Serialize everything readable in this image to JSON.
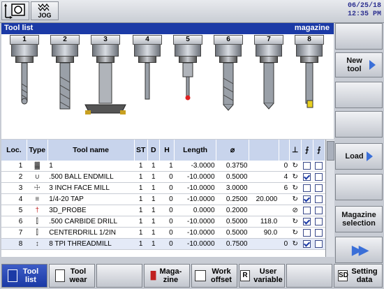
{
  "header": {
    "mode": "JOG",
    "date": "06/25/18",
    "time": "12:35 PM"
  },
  "panel": {
    "title": "Tool list",
    "right_label": "magazine"
  },
  "magazine": {
    "locations": [
      "1",
      "2",
      "3",
      "4",
      "5",
      "6",
      "7",
      "8"
    ]
  },
  "table": {
    "headers": [
      "Loc.",
      "Type",
      "Tool name",
      "ST",
      "D",
      "H",
      "Length",
      "⌀",
      "",
      "",
      ""
    ],
    "rows": [
      {
        "loc": "1",
        "name": "1",
        "st": "1",
        "d": "1",
        "h": "1",
        "length": "-3.0000",
        "dia": "0.3750",
        "extra": "",
        "n": "0",
        "sp": "↻",
        "c1": false,
        "c2": false
      },
      {
        "loc": "2",
        "name": ".500 BALL ENDMILL",
        "st": "1",
        "d": "1",
        "h": "0",
        "length": "-10.0000",
        "dia": "0.5000",
        "extra": "",
        "n": "4",
        "sp": "↻",
        "c1": true,
        "c2": false
      },
      {
        "loc": "3",
        "name": "3 INCH FACE MILL",
        "st": "1",
        "d": "1",
        "h": "0",
        "length": "-10.0000",
        "dia": "3.0000",
        "extra": "",
        "n": "6",
        "sp": "↻",
        "c1": false,
        "c2": false
      },
      {
        "loc": "4",
        "name": "1/4-20 TAP",
        "st": "1",
        "d": "1",
        "h": "0",
        "length": "-10.0000",
        "dia": "0.2500",
        "extra": "20.000",
        "n": "",
        "sp": "↻",
        "c1": true,
        "c2": false
      },
      {
        "loc": "5",
        "name": "3D_PROBE",
        "st": "1",
        "d": "1",
        "h": "0",
        "length": "0.0000",
        "dia": "0.2000",
        "extra": "",
        "n": "",
        "sp": "⊘",
        "c1": false,
        "c2": false
      },
      {
        "loc": "6",
        "name": ".500 CARBIDE DRILL",
        "st": "1",
        "d": "1",
        "h": "0",
        "length": "-10.0000",
        "dia": "0.5000",
        "extra": "118.0",
        "n": "",
        "sp": "↻",
        "c1": true,
        "c2": false
      },
      {
        "loc": "7",
        "name": "CENTERDRILL 1/2IN",
        "st": "1",
        "d": "1",
        "h": "0",
        "length": "-10.0000",
        "dia": "0.5000",
        "extra": "90.0",
        "n": "",
        "sp": "↻",
        "c1": false,
        "c2": false
      },
      {
        "loc": "8",
        "name": "8 TPI THREADMILL",
        "st": "1",
        "d": "1",
        "h": "0",
        "length": "-10.0000",
        "dia": "0.7500",
        "extra": "",
        "n": "0",
        "sp": "↻",
        "c1": true,
        "c2": false
      }
    ]
  },
  "softkeys": {
    "new_tool": "New tool",
    "load": "Load",
    "magazine_selection": "Magazine selection"
  },
  "hkeys": {
    "tool_list": "Tool list",
    "tool_wear": "Tool wear",
    "magazine": "Maga-zine",
    "work_offset": "Work offset",
    "user_variable": "User variable",
    "setting_data": "Setting data"
  }
}
